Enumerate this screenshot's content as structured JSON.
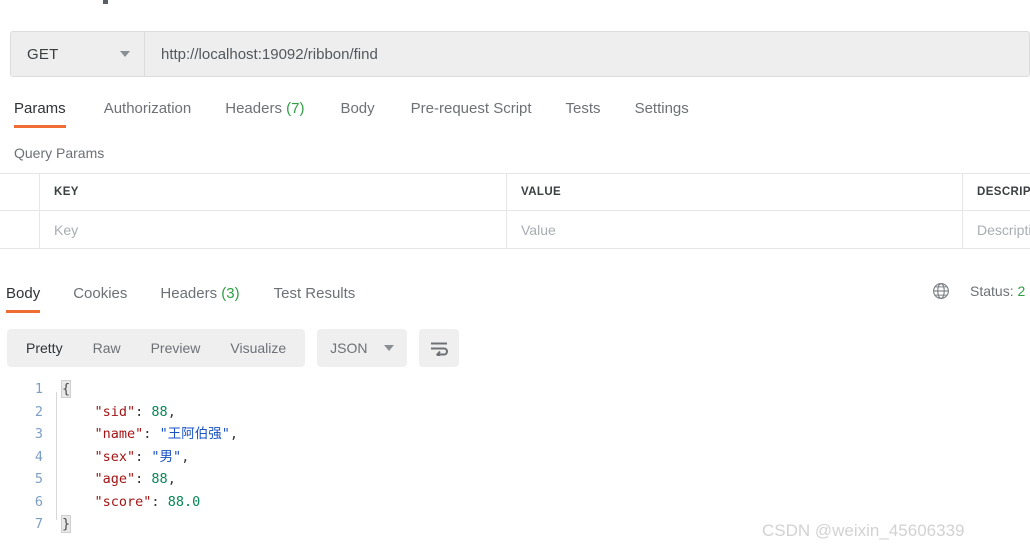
{
  "request": {
    "method": "GET",
    "url": "http://localhost:19092/ribbon/find",
    "tabs": [
      {
        "label": "Params",
        "count": ""
      },
      {
        "label": "Authorization",
        "count": ""
      },
      {
        "label": "Headers",
        "count": "(7)"
      },
      {
        "label": "Body",
        "count": ""
      },
      {
        "label": "Pre-request Script",
        "count": ""
      },
      {
        "label": "Tests",
        "count": ""
      },
      {
        "label": "Settings",
        "count": ""
      }
    ]
  },
  "query_params": {
    "title": "Query Params",
    "headers": [
      "KEY",
      "VALUE",
      "DESCRIPTION"
    ],
    "placeholder_row": [
      "Key",
      "Value",
      "Description"
    ]
  },
  "response": {
    "tabs": [
      {
        "label": "Body",
        "count": ""
      },
      {
        "label": "Cookies",
        "count": ""
      },
      {
        "label": "Headers",
        "count": "(3)"
      },
      {
        "label": "Test Results",
        "count": ""
      }
    ],
    "status_label": "Status:",
    "status_code": "2",
    "toolbar": {
      "views": [
        "Pretty",
        "Raw",
        "Preview",
        "Visualize"
      ],
      "format": "JSON"
    },
    "line_numbers": [
      "1",
      "2",
      "3",
      "4",
      "5",
      "6",
      "7"
    ],
    "json": {
      "open_brace": "{",
      "close_brace": "}",
      "rows": [
        {
          "key": "\"sid\"",
          "colon": ": ",
          "value": "88",
          "type": "num",
          "comma": ","
        },
        {
          "key": "\"name\"",
          "colon": ": ",
          "value": "\"王阿伯强\"",
          "type": "str",
          "comma": ","
        },
        {
          "key": "\"sex\"",
          "colon": ": ",
          "value": "\"男\"",
          "type": "str",
          "comma": ","
        },
        {
          "key": "\"age\"",
          "colon": ": ",
          "value": "88",
          "type": "num",
          "comma": ","
        },
        {
          "key": "\"score\"",
          "colon": ": ",
          "value": "88.0",
          "type": "num",
          "comma": ""
        }
      ]
    }
  },
  "watermark": "CSDN @weixin_45606339",
  "colors": {
    "accent": "#ef6c33",
    "count_green": "#2f9e44",
    "json_key": "#a31515",
    "json_number": "#098658",
    "json_string": "#1a52c4"
  }
}
